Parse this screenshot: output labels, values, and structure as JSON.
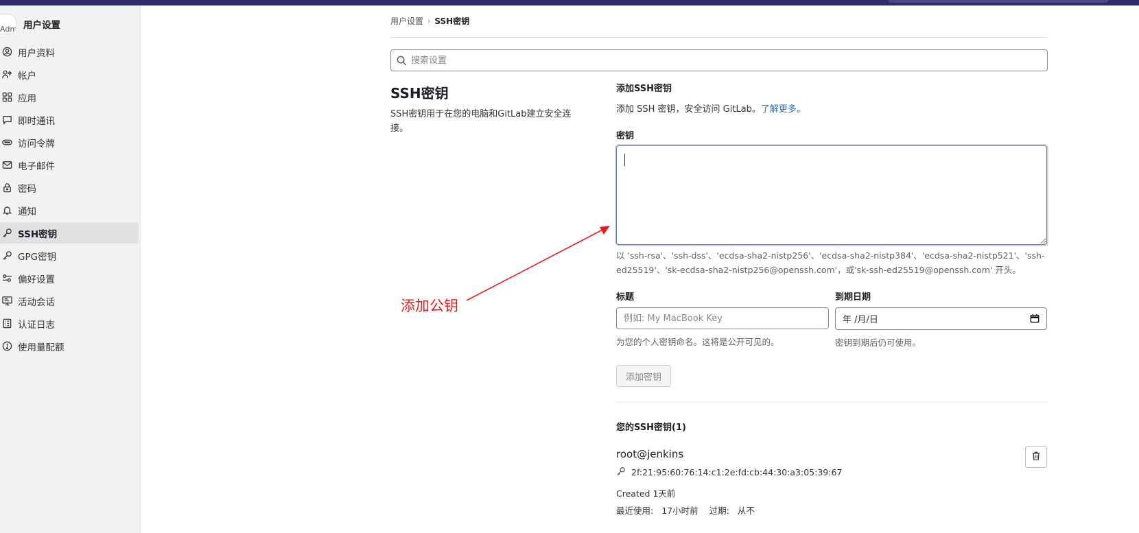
{
  "sidebar": {
    "avatar_alt": "Adm",
    "title": "用户设置",
    "items": [
      {
        "label": "用户资料",
        "icon": "user-circle-icon"
      },
      {
        "label": "帐户",
        "icon": "account-icon"
      },
      {
        "label": "应用",
        "icon": "applications-icon"
      },
      {
        "label": "即时通讯",
        "icon": "comment-icon"
      },
      {
        "label": "访问令牌",
        "icon": "token-icon"
      },
      {
        "label": "电子邮件",
        "icon": "mail-icon"
      },
      {
        "label": "密码",
        "icon": "lock-icon"
      },
      {
        "label": "通知",
        "icon": "bell-icon"
      },
      {
        "label": "SSH密钥",
        "icon": "key-icon",
        "active": true
      },
      {
        "label": "GPG密钥",
        "icon": "key-icon"
      },
      {
        "label": "偏好设置",
        "icon": "preferences-icon"
      },
      {
        "label": "活动会话",
        "icon": "monitor-icon"
      },
      {
        "label": "认证日志",
        "icon": "log-icon"
      },
      {
        "label": "使用量配额",
        "icon": "quota-icon"
      }
    ]
  },
  "breadcrumb": {
    "parent": "用户设置",
    "current": "SSH密钥"
  },
  "search": {
    "placeholder": "搜索设置"
  },
  "section": {
    "title": "SSH密钥",
    "description": "SSH密钥用于在您的电脑和GitLab建立安全连接。"
  },
  "form": {
    "heading": "添加SSH密钥",
    "description": "添加 SSH 密钥，安全访问 GitLab。",
    "learn_more": "了解更多",
    "period": "。",
    "key_label": "密钥",
    "key_value": "",
    "key_help": "以 'ssh-rsa'、'ssh-dss'、'ecdsa-sha2-nistp256'、'ecdsa-sha2-nistp384'、'ecdsa-sha2-nistp521'、'ssh-ed25519'、'sk-ecdsa-sha2-nistp256@openssh.com'，或'sk-ssh-ed25519@openssh.com' 开头。",
    "title_label": "标题",
    "title_placeholder": "例如: My MacBook Key",
    "title_help": "为您的个人密钥命名。这将是公开可见的。",
    "expiry_label": "到期日期",
    "expiry_value": "年 /月/日",
    "expiry_help": "密钥到期后仍可使用。",
    "submit_label": "添加密钥"
  },
  "keys": {
    "heading": "您的SSH密钥(1)",
    "items": [
      {
        "title": "root@jenkins",
        "fingerprint": "2f:21:95:60:76:14:c1:2e:fd:cb:44:30:a3:05:39:67",
        "created": "Created 1天前",
        "last_used_label": "最近使用:",
        "last_used": "17小时前",
        "expires_label": "过期:",
        "expires": "从不"
      }
    ]
  },
  "annotation": {
    "text": "添加公钥",
    "color": "#e0201f"
  },
  "colors": {
    "topbar": "#2f2a6b",
    "link": "#1f75cb",
    "sidebar_bg": "#f2f2f3"
  }
}
